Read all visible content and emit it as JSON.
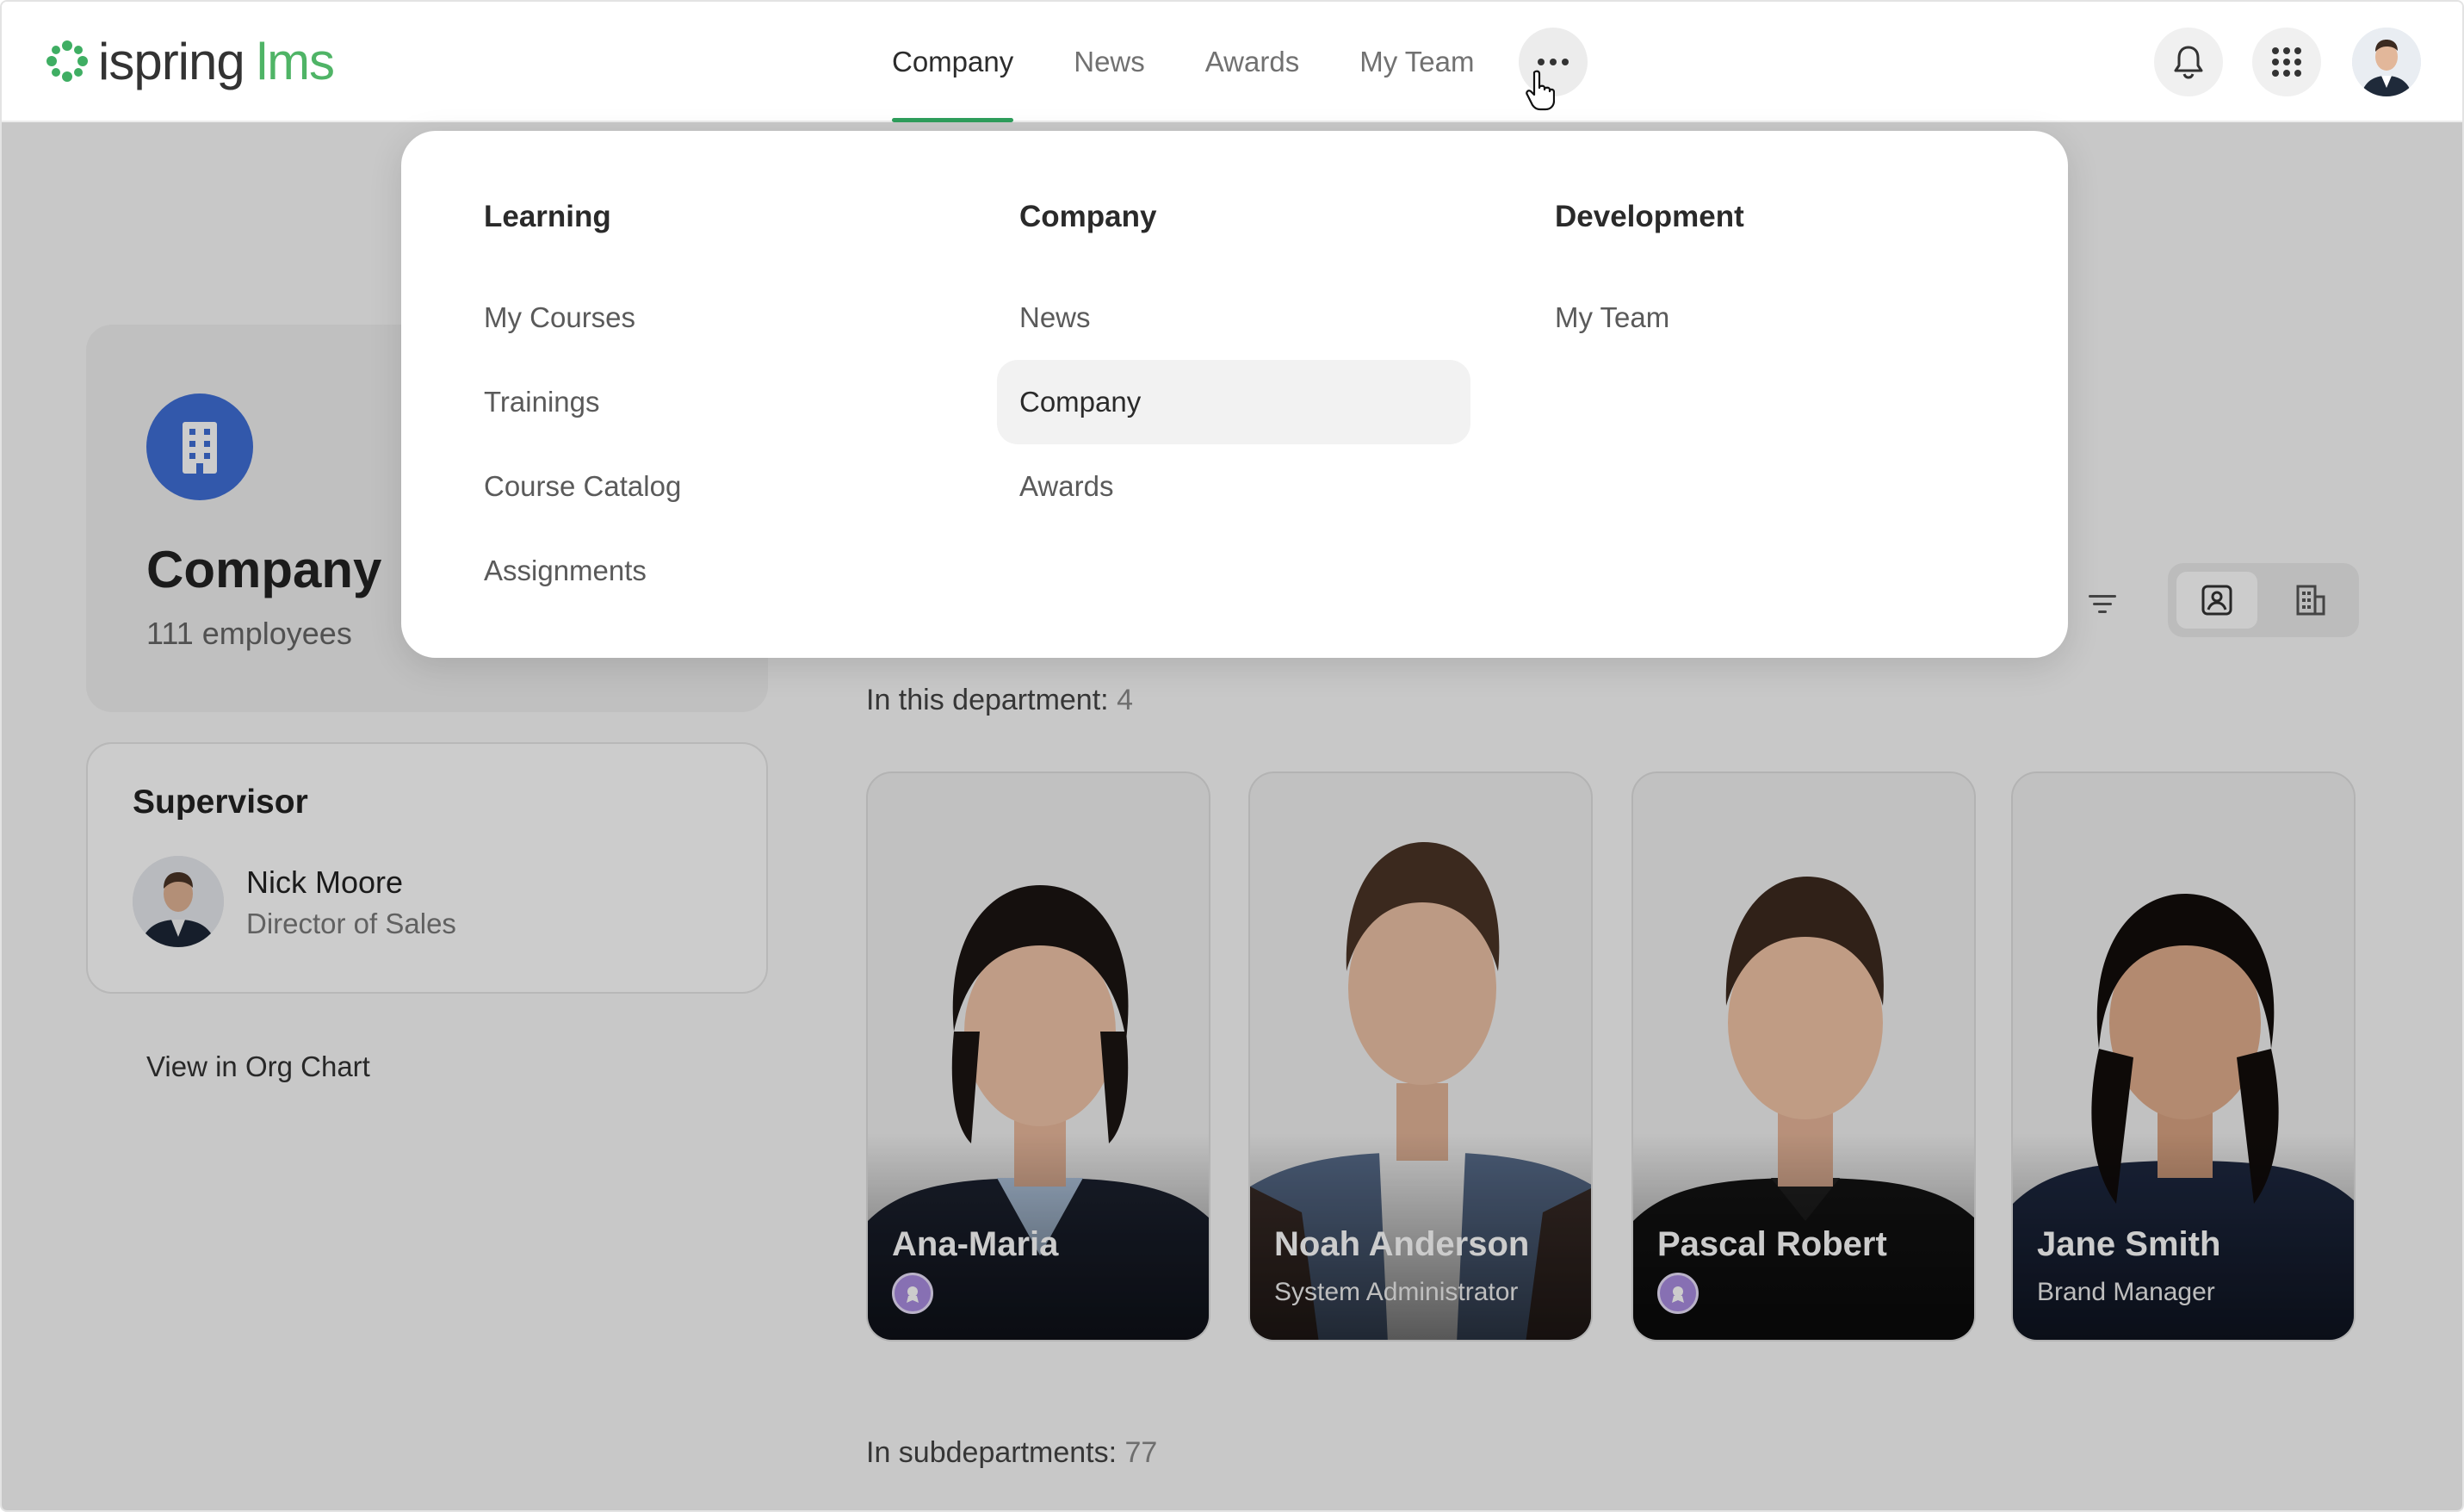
{
  "brand": {
    "name_part1": "ispring",
    "name_part2": "lms",
    "accent": "#2e9e5c",
    "logo_green": "#4fb466"
  },
  "nav": {
    "items": [
      {
        "label": "Company",
        "active": true
      },
      {
        "label": "News",
        "active": false
      },
      {
        "label": "Awards",
        "active": false
      },
      {
        "label": "My Team",
        "active": false
      }
    ],
    "more_icon": "ellipsis-icon"
  },
  "header_actions": {
    "bell_icon": "bell-icon",
    "apps_icon": "apps-grid-icon"
  },
  "mega_menu": {
    "columns": [
      {
        "heading": "Learning",
        "items": [
          "My Courses",
          "Trainings",
          "Course Catalog",
          "Assignments"
        ]
      },
      {
        "heading": "Company",
        "items": [
          "News",
          "Company",
          "Awards"
        ],
        "active_index": 1
      },
      {
        "heading": "Development",
        "items": [
          "My Team"
        ]
      }
    ]
  },
  "company": {
    "title": "Company",
    "employees": "111 employees",
    "icon": "building-icon",
    "icon_color": "#3f6fd6"
  },
  "supervisor": {
    "heading": "Supervisor",
    "name": "Nick Moore",
    "role": "Director of Sales"
  },
  "org_chart_link": "View in Org Chart",
  "department": {
    "label": "In this department:",
    "count": "4"
  },
  "subdepartments": {
    "label": "In subdepartments:",
    "count": "77"
  },
  "people": [
    {
      "name": "Ana-Maria",
      "role": "",
      "badge": true
    },
    {
      "name": "Noah Anderson",
      "role": "System Administrator",
      "badge": false
    },
    {
      "name": "Pascal Robert",
      "role": "",
      "badge": true
    },
    {
      "name": "Jane Smith",
      "role": "Brand Manager",
      "badge": false
    }
  ]
}
